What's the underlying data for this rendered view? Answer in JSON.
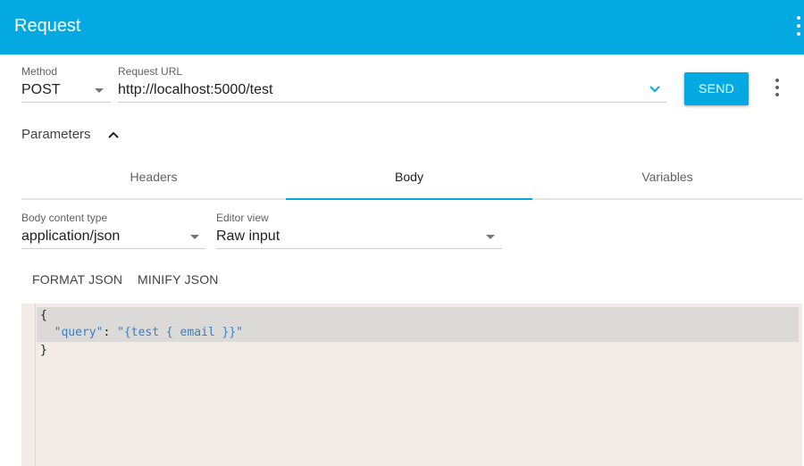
{
  "appbar": {
    "title": "Request"
  },
  "request": {
    "method_label": "Method",
    "method_value": "POST",
    "url_label": "Request URL",
    "url_value": "http://localhost:5000/test",
    "send_label": "SEND"
  },
  "parameters": {
    "label": "Parameters"
  },
  "tabs": [
    {
      "label": "Headers"
    },
    {
      "label": "Body"
    },
    {
      "label": "Variables"
    }
  ],
  "active_tab": "Body",
  "body": {
    "content_type_label": "Body content type",
    "content_type_value": "application/json",
    "editor_view_label": "Editor view",
    "editor_view_value": "Raw input",
    "format_label": "FORMAT JSON",
    "minify_label": "MINIFY JSON"
  },
  "editor": {
    "open_brace": "{",
    "key": "\"query\"",
    "separator": ": ",
    "value": "\"{test { email }}\"",
    "close_brace": "}"
  },
  "colors": {
    "accent": "#03a9e0",
    "editor_background": "#f2ebe8",
    "code_string": "#3d7fc3"
  }
}
